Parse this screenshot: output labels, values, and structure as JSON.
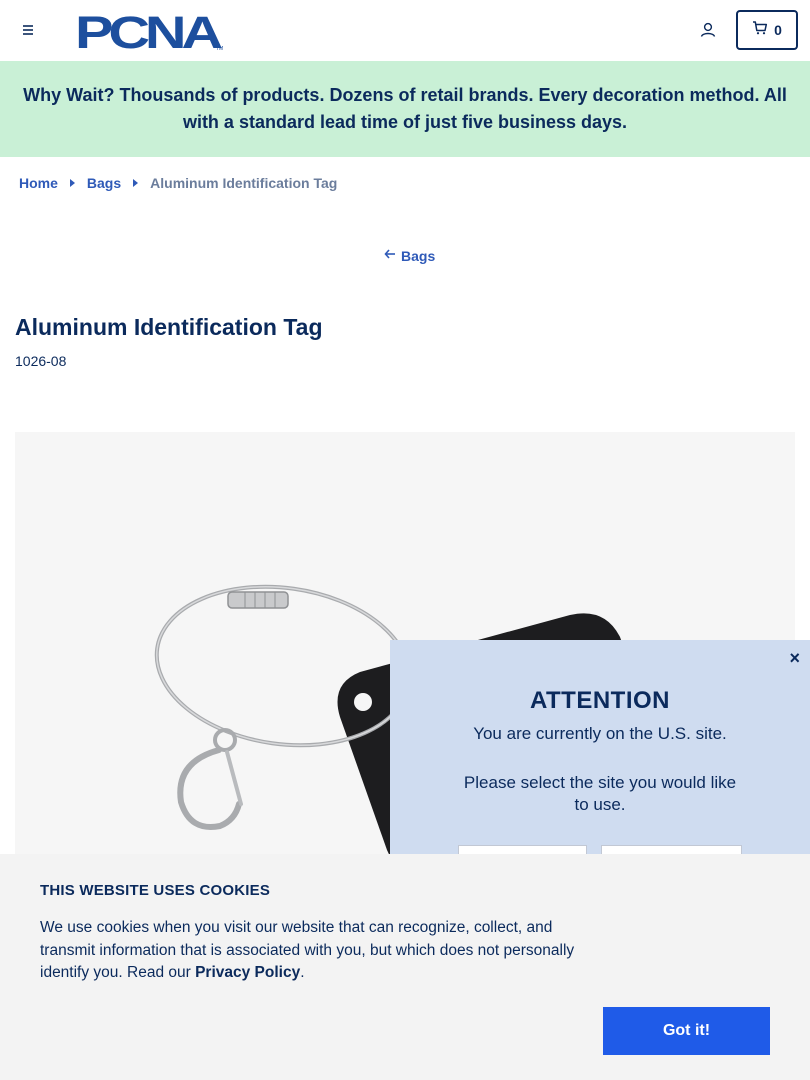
{
  "header": {
    "logo_text": "PCNA",
    "cart_count": "0",
    "icons": {
      "menu": "hamburger-menu-icon",
      "account": "user-icon",
      "cart": "cart-icon"
    }
  },
  "promo": {
    "text": "Why Wait? Thousands of products. Dozens of retail brands. Every decoration method. All with a standard lead time of just five business days."
  },
  "breadcrumb": {
    "items": [
      {
        "label": "Home"
      },
      {
        "label": "Bags"
      }
    ],
    "current": "Aluminum Identification Tag"
  },
  "back_link": {
    "label": "Bags"
  },
  "product": {
    "title": "Aluminum Identification Tag",
    "sku": "1026-08"
  },
  "attention_modal": {
    "title": "ATTENTION",
    "subtitle": "You are currently on the U.S. site.",
    "prompt": "Please select the site you would like to use.",
    "close_symbol": "×"
  },
  "cookie_bar": {
    "title": "THIS WEBSITE USES COOKIES",
    "text": "We use cookies when you visit our website that can recognize, collect, and transmit information that is associated with you, but which does not personally identify you. Read our ",
    "link_label": "Privacy Policy",
    "text_end": ".",
    "button_label": "Got it!"
  },
  "colors": {
    "brand_navy": "#0b2a5c",
    "link_blue": "#2f5ab8",
    "promo_bg": "#c9f0d6",
    "modal_bg": "#cfdcf0",
    "cookie_button": "#1f5be8"
  }
}
